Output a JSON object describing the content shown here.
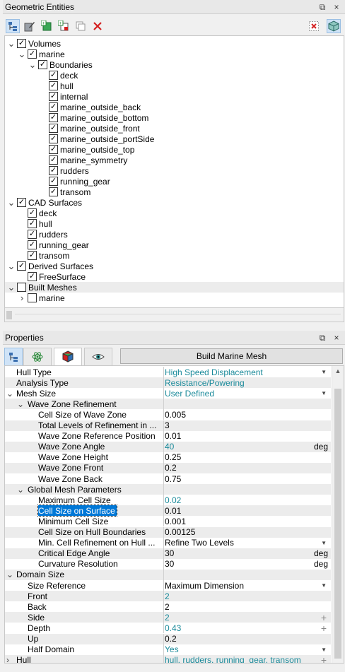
{
  "geo_panel": {
    "title": "Geometric Entities"
  },
  "props_panel": {
    "title": "Properties",
    "build_button": "Build Marine Mesh"
  },
  "window_controls": {
    "float": "⧉",
    "close": "×"
  },
  "tree": [
    {
      "label": "Volumes",
      "level": 0,
      "expand": "v",
      "checked": true
    },
    {
      "label": "marine",
      "level": 1,
      "expand": "v",
      "checked": true
    },
    {
      "label": "Boundaries",
      "level": 2,
      "expand": "v",
      "checked": true
    },
    {
      "label": "deck",
      "level": 3,
      "expand": "",
      "checked": true
    },
    {
      "label": "hull",
      "level": 3,
      "expand": "",
      "checked": true
    },
    {
      "label": "internal",
      "level": 3,
      "expand": "",
      "checked": true
    },
    {
      "label": "marine_outside_back",
      "level": 3,
      "expand": "",
      "checked": true
    },
    {
      "label": "marine_outside_bottom",
      "level": 3,
      "expand": "",
      "checked": true
    },
    {
      "label": "marine_outside_front",
      "level": 3,
      "expand": "",
      "checked": true
    },
    {
      "label": "marine_outside_portSide",
      "level": 3,
      "expand": "",
      "checked": true
    },
    {
      "label": "marine_outside_top",
      "level": 3,
      "expand": "",
      "checked": true
    },
    {
      "label": "marine_symmetry",
      "level": 3,
      "expand": "",
      "checked": true
    },
    {
      "label": "rudders",
      "level": 3,
      "expand": "",
      "checked": true
    },
    {
      "label": "running_gear",
      "level": 3,
      "expand": "",
      "checked": true
    },
    {
      "label": "transom",
      "level": 3,
      "expand": "",
      "checked": true
    },
    {
      "label": "CAD Surfaces",
      "level": 0,
      "expand": "v",
      "checked": true
    },
    {
      "label": "deck",
      "level": 1,
      "expand": "",
      "checked": true
    },
    {
      "label": "hull",
      "level": 1,
      "expand": "",
      "checked": true
    },
    {
      "label": "rudders",
      "level": 1,
      "expand": "",
      "checked": true
    },
    {
      "label": "running_gear",
      "level": 1,
      "expand": "",
      "checked": true
    },
    {
      "label": "transom",
      "level": 1,
      "expand": "",
      "checked": true
    },
    {
      "label": "Derived Surfaces",
      "level": 0,
      "expand": "v",
      "checked": true
    },
    {
      "label": "FreeSurface",
      "level": 1,
      "expand": "",
      "checked": true
    },
    {
      "label": "Built Meshes",
      "level": 0,
      "expand": "v",
      "checked": false,
      "shaded": true
    },
    {
      "label": "marine",
      "level": 1,
      "expand": ">",
      "checked": false
    }
  ],
  "properties": [
    {
      "name": "Hull Type",
      "level": 0,
      "expand": "",
      "value": "High Speed Displacement",
      "blue": true,
      "dd": true
    },
    {
      "name": "Analysis Type",
      "level": 0,
      "expand": "",
      "value": "Resistance/Powering",
      "blue": true,
      "shade": true
    },
    {
      "name": "Mesh Size",
      "level": 0,
      "expand": "v",
      "value": "User Defined",
      "blue": true,
      "dd": true
    },
    {
      "name": "Wave Zone Refinement",
      "level": 1,
      "expand": "v",
      "value": "",
      "shade": true
    },
    {
      "name": "Cell Size of Wave Zone",
      "level": 2,
      "expand": "",
      "value": "0.005"
    },
    {
      "name": "Total Levels of Refinement in ...",
      "level": 2,
      "expand": "",
      "value": "3",
      "shade": true
    },
    {
      "name": "Wave Zone Reference Position",
      "level": 2,
      "expand": "",
      "value": "0.01"
    },
    {
      "name": "Wave Zone Angle",
      "level": 2,
      "expand": "",
      "value": "40",
      "blue": true,
      "unit": "deg",
      "shade": true
    },
    {
      "name": "Wave Zone Height",
      "level": 2,
      "expand": "",
      "value": "0.25"
    },
    {
      "name": "Wave Zone Front",
      "level": 2,
      "expand": "",
      "value": "0.2",
      "shade": true
    },
    {
      "name": "Wave Zone Back",
      "level": 2,
      "expand": "",
      "value": "0.75"
    },
    {
      "name": "Global Mesh Parameters",
      "level": 1,
      "expand": "v",
      "value": "",
      "shade": true
    },
    {
      "name": "Maximum Cell Size",
      "level": 2,
      "expand": "",
      "value": "0.02",
      "blue": true
    },
    {
      "name": "Cell Size on Surface",
      "level": 2,
      "expand": "",
      "value": "0.01",
      "selected": true,
      "shade": true
    },
    {
      "name": "Minimum Cell Size",
      "level": 2,
      "expand": "",
      "value": "0.001"
    },
    {
      "name": "Cell Size on Hull Boundaries",
      "level": 2,
      "expand": "",
      "value": "0.00125",
      "shade": true
    },
    {
      "name": "Min. Cell Refinement on Hull ...",
      "level": 2,
      "expand": "",
      "value": "Refine Two Levels",
      "dd": true
    },
    {
      "name": "Critical Edge Angle",
      "level": 2,
      "expand": "",
      "value": "30",
      "unit": "deg",
      "shade": true
    },
    {
      "name": "Curvature Resolution",
      "level": 2,
      "expand": "",
      "value": "30",
      "unit": "deg"
    },
    {
      "name": "Domain Size",
      "level": 0,
      "expand": "v",
      "value": "",
      "shade": true
    },
    {
      "name": "Size Reference",
      "level": 1,
      "expand": "",
      "value": "Maximum Dimension",
      "dd": true
    },
    {
      "name": "Front",
      "level": 1,
      "expand": "",
      "value": "2",
      "blue": true,
      "shade": true
    },
    {
      "name": "Back",
      "level": 1,
      "expand": "",
      "value": "2"
    },
    {
      "name": "Side",
      "level": 1,
      "expand": "",
      "value": "2",
      "blue": true,
      "plus": true,
      "shade": true
    },
    {
      "name": "Depth",
      "level": 1,
      "expand": "",
      "value": "0.43",
      "blue": true,
      "plus": true
    },
    {
      "name": "Up",
      "level": 1,
      "expand": "",
      "value": "0.2",
      "shade": true
    },
    {
      "name": "Half Domain",
      "level": 1,
      "expand": "",
      "value": "Yes",
      "blue": true,
      "dd": true
    },
    {
      "name": "Hull",
      "level": 0,
      "expand": ">",
      "value": "hull, rudders, running_gear, transom",
      "blue": true,
      "plus": true,
      "shade": true
    }
  ],
  "colors": {
    "accent": "#0078d7",
    "value_blue": "#1a8a9a",
    "delete_red": "#d42020"
  }
}
